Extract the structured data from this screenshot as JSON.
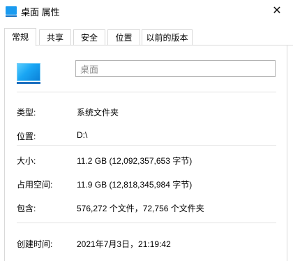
{
  "window": {
    "title": "桌面 属性",
    "close_glyph": "✕"
  },
  "tabs": [
    {
      "label": "常规",
      "active": true
    },
    {
      "label": "共享",
      "active": false
    },
    {
      "label": "安全",
      "active": false
    },
    {
      "label": "位置",
      "active": false
    },
    {
      "label": "以前的版本",
      "active": false
    }
  ],
  "general": {
    "name_value": "桌面",
    "rows": [
      {
        "label": "类型:",
        "value": "系统文件夹"
      },
      {
        "label": "位置:",
        "value": "D:\\"
      },
      {
        "label": "大小:",
        "value": "11.2 GB (12,092,357,653 字节)"
      },
      {
        "label": "占用空间:",
        "value": "11.9 GB (12,818,345,984 字节)"
      },
      {
        "label": "包含:",
        "value": "576,272 个文件，72,756 个文件夹"
      },
      {
        "label": "创建时间:",
        "value": "2021年7月3日，21:19:42"
      }
    ]
  },
  "colors": {
    "folder_icon": "#1aa6f4",
    "border": "#d9d9d9"
  }
}
